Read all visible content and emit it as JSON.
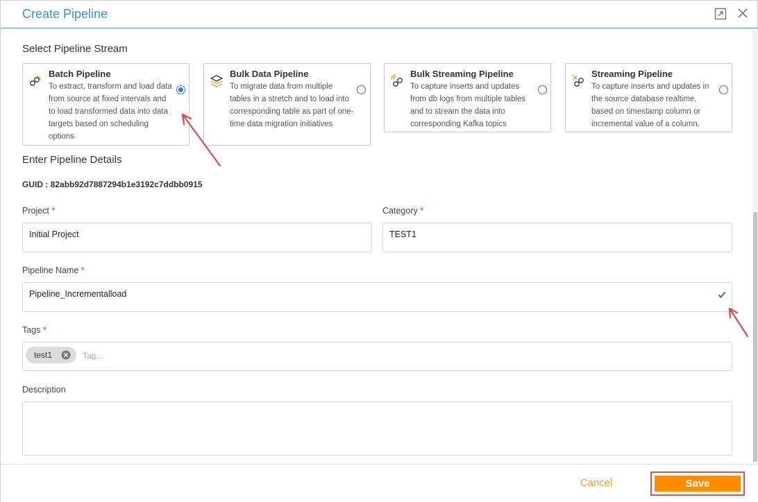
{
  "dialog": {
    "title": "Create Pipeline",
    "expand_icon": "expand-icon",
    "close_icon": "close-icon"
  },
  "stream_section": {
    "title": "Select Pipeline Stream",
    "cards": [
      {
        "title": "Batch Pipeline",
        "description": "To extract, transform and load data from source at fixed intervals and to load transformed data into data targets based on scheduling options",
        "icon": "batch-pipeline-icon",
        "selected": true
      },
      {
        "title": "Bulk Data Pipeline",
        "description": "To migrate data from multiple tables in a stretch and to load into corresponding table as part of one-time data migration initiatives",
        "icon": "layers-icon",
        "selected": false
      },
      {
        "title": "Bulk Streaming Pipeline",
        "description": "To capture inserts and updates from db logs from multiple tables and to stream the data into corresponding Kafka topics",
        "icon": "bulk-streaming-icon",
        "selected": false
      },
      {
        "title": "Streaming Pipeline",
        "description": "To capture inserts and updates in the source database realtime, based on timestamp column or incremental value of a column.",
        "icon": "streaming-icon",
        "selected": false
      }
    ]
  },
  "details_section": {
    "title": "Enter Pipeline Details",
    "guid_label": "GUID :",
    "guid_value": "82abb92d7887294b1e3192c7ddbb0915"
  },
  "form": {
    "project": {
      "label": "Project",
      "required_mark": "*",
      "value": "Initial Project"
    },
    "category": {
      "label": "Category",
      "required_mark": "*",
      "value": "TEST1"
    },
    "pipeline_name": {
      "label": "Pipeline Name",
      "required_mark": "*",
      "value": "Pipeline_Incrementalload",
      "valid_icon": "check-icon"
    },
    "tags": {
      "label": "Tags",
      "required_mark": "*",
      "chips": [
        "test1"
      ],
      "placeholder": "Tag..."
    },
    "description": {
      "label": "Description",
      "value": ""
    }
  },
  "footer": {
    "cancel_label": "Cancel",
    "save_label": "Save"
  },
  "colors": {
    "title_blue": "#3d8fd6",
    "radio_blue": "#2f7ae5",
    "save_orange": "#ff8c00",
    "cancel_orange": "#f0a030",
    "required_red": "#d9342b",
    "annotation_red": "#e04848",
    "valid_green": "#2e8b2e"
  }
}
